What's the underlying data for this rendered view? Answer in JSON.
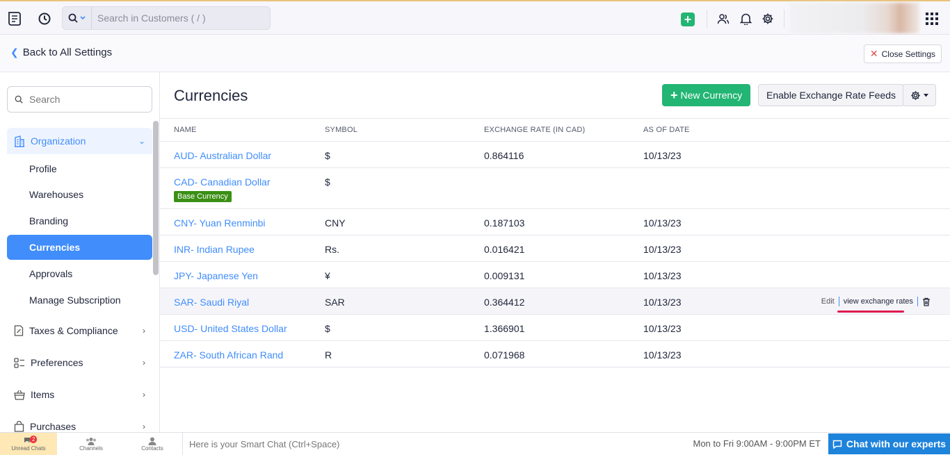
{
  "topbar": {
    "search_placeholder": "Search in Customers ( / )",
    "icons": [
      "app-logo-icon",
      "history-icon",
      "search-icon",
      "add-icon",
      "users-icon",
      "bell-icon",
      "gear-icon",
      "apps-grid-icon"
    ]
  },
  "settings_header": {
    "back_label": "Back to All Settings",
    "close_label": "Close Settings"
  },
  "sidebar": {
    "search_placeholder": "Search",
    "organization": "Organization",
    "sub_items": [
      "Profile",
      "Warehouses",
      "Branding",
      "Currencies",
      "Approvals",
      "Manage Subscription"
    ],
    "active": "Currencies",
    "groups": [
      "Taxes & Compliance",
      "Preferences",
      "Items",
      "Purchases"
    ]
  },
  "main": {
    "title": "Currencies",
    "new_button": "New Currency",
    "enable_button": "Enable Exchange Rate Feeds",
    "columns": [
      "NAME",
      "SYMBOL",
      "EXCHANGE RATE (IN CAD)",
      "AS OF DATE"
    ],
    "base_badge": "Base Currency",
    "rows": [
      {
        "name": "AUD- Australian Dollar",
        "symbol": "$",
        "rate": "0.864116",
        "date": "10/13/23"
      },
      {
        "name": "CAD- Canadian Dollar",
        "symbol": "$",
        "rate": "",
        "date": ""
      },
      {
        "name": "CNY- Yuan Renminbi",
        "symbol": "CNY",
        "rate": "0.187103",
        "date": "10/13/23"
      },
      {
        "name": "INR- Indian Rupee",
        "symbol": "Rs.",
        "rate": "0.016421",
        "date": "10/13/23"
      },
      {
        "name": "JPY- Japanese Yen",
        "symbol": "¥",
        "rate": "0.009131",
        "date": "10/13/23"
      },
      {
        "name": "SAR- Saudi Riyal",
        "symbol": "SAR",
        "rate": "0.364412",
        "date": "10/13/23"
      },
      {
        "name": "USD- United States Dollar",
        "symbol": "$",
        "rate": "1.366901",
        "date": "10/13/23"
      },
      {
        "name": "ZAR- South African Rand",
        "symbol": "R",
        "rate": "0.071968",
        "date": "10/13/23"
      }
    ],
    "row_actions": {
      "edit": "Edit",
      "view": "view exchange rates"
    }
  },
  "bottombar": {
    "unread_label": "Unread Chats",
    "unread_count": "2",
    "channels_label": "Channels",
    "contacts_label": "Contacts",
    "smart_chat_placeholder": "Here is your Smart Chat (Ctrl+Space)",
    "hours": "Mon to Fri 9:00AM - 9:00PM ET",
    "chat_button": "Chat with our experts"
  },
  "colors": {
    "accent": "#408dfb",
    "green": "#22b573",
    "badge": "#3a8f14",
    "chat": "#1e83db",
    "highlight": "#e01a4f"
  }
}
